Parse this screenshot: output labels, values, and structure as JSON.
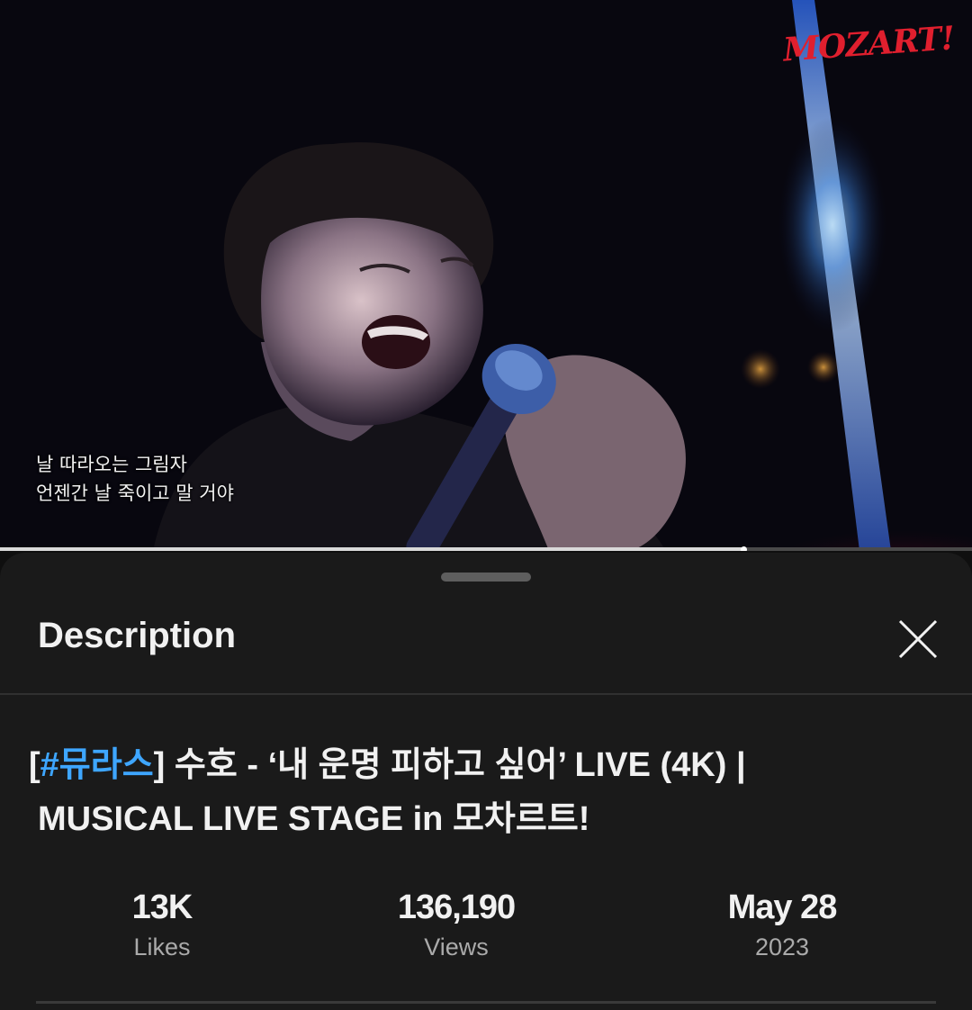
{
  "video": {
    "logo_text": "MOZART!",
    "subtitles": [
      "날 따라오는 그림자",
      "언젠간 날 죽이고 말 거야"
    ],
    "progress": 0.765
  },
  "description_panel": {
    "title": "Description",
    "close_icon": "close-icon",
    "video_title": {
      "hashtag_open": "[",
      "hashtag": "#뮤라스",
      "hashtag_close": "]",
      "line1_rest": " 수호 - ‘내 운명 피하고 싶어’ LIVE (4K) |",
      "line2": "MUSICAL LIVE STAGE in 모차르트!"
    },
    "stats": [
      {
        "value": "13K",
        "label": "Likes"
      },
      {
        "value": "136,190",
        "label": "Views"
      },
      {
        "value": "May 28",
        "label": "2023"
      }
    ]
  },
  "colors": {
    "background": "#0f0f0f",
    "sheet": "#1a1a1a",
    "hashtag": "#3ea6ff",
    "logo": "#e01f2e",
    "muted_text": "#aaaaaa"
  }
}
